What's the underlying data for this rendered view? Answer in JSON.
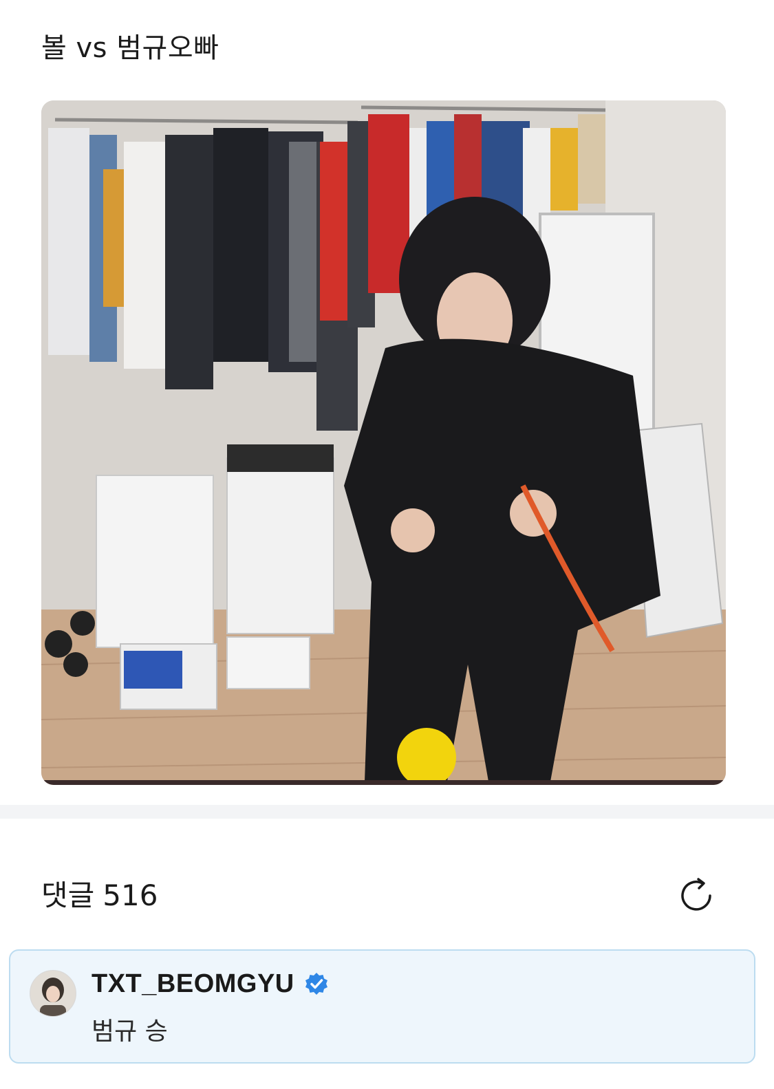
{
  "post": {
    "title": "볼 vs 범규오빠",
    "media_icon": "video-thumbnail"
  },
  "comments": {
    "label": "댓글",
    "count": "516",
    "refresh_icon": "refresh-icon",
    "items": [
      {
        "author": "TXT_BEOMGYU",
        "verified": true,
        "text": "범규 승"
      }
    ]
  },
  "colors": {
    "card_bg": "#eef6fc",
    "card_border": "#bcdcf0",
    "verified_badge": "#2f87e6",
    "divider": "#f3f4f6"
  }
}
